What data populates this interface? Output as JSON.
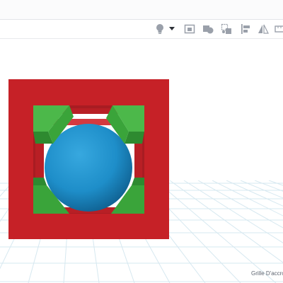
{
  "toolbar": {
    "tools": [
      {
        "name": "light-bulb-icon"
      },
      {
        "name": "dropdown-arrow-icon"
      },
      {
        "name": "view-box-icon"
      },
      {
        "name": "shape-icon"
      },
      {
        "name": "group-icon"
      },
      {
        "name": "align-icon"
      },
      {
        "name": "mirror-icon"
      },
      {
        "name": "ruler-icon"
      }
    ]
  },
  "viewport": {
    "grid_label": "Grille D'accroch"
  },
  "colors": {
    "frame_red": "#c62127",
    "wedge_green": "#3aa43a",
    "sphere_blue": "#1e8ec9",
    "grid_line": "#cfe3ec"
  }
}
